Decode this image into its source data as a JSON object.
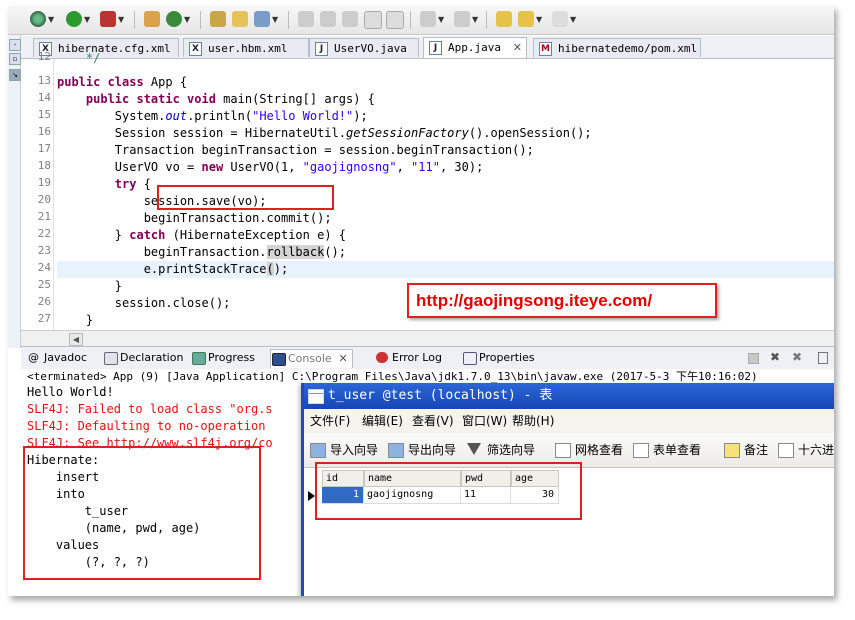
{
  "editor_tabs": [
    {
      "label": "hibernate.cfg.xml",
      "icon": "X"
    },
    {
      "label": "user.hbm.xml",
      "icon": "X"
    },
    {
      "label": "UserVO.java",
      "icon": "J"
    },
    {
      "label": "App.java",
      "icon": "J"
    },
    {
      "label": "hibernatedemo/pom.xml",
      "icon": "M"
    }
  ],
  "line_numbers": [
    "12",
    "13",
    "14",
    "15",
    "16",
    "17",
    "18",
    "19",
    "20",
    "21",
    "22",
    "23",
    "24",
    "25",
    "26",
    "27"
  ],
  "code": {
    "l13": {
      "kw": "public class",
      "rest": " App {"
    },
    "l14": {
      "kw": "public static void",
      "rest": " main(String[] args) {"
    },
    "l15": {
      "a": "System.",
      "fld": "out",
      "b": ".println(",
      "str": "\"Hello World!\"",
      "c": ");"
    },
    "l16": {
      "a": "Session session = HibernateUtil.",
      "ital": "getSessionFactory",
      "c": "().openSession();"
    },
    "l17": {
      "text": "Transaction beginTransaction = session.beginTransaction();"
    },
    "l18": {
      "a": "UserVO vo = ",
      "kw": "new",
      "b": " UserVO(1, ",
      "str1": "\"gaojignosng\"",
      "c": ", ",
      "str2": "\"11\"",
      "d": ", 30);"
    },
    "l19": {
      "kw": "try",
      "rest": " {"
    },
    "l20": {
      "text": "session.save(vo);"
    },
    "l21": {
      "text": "beginTransaction.commit();"
    },
    "l22": {
      "a": "} ",
      "kw": "catch",
      "b": " (HibernateException e) {"
    },
    "l23": {
      "a": "beginTransaction.",
      "occ": "rollback",
      "c": "();"
    },
    "l24": {
      "a": "e.printStackTrace",
      "occ": "(",
      "c": ");"
    },
    "l25": {
      "text": "}"
    },
    "l26": {
      "text": "session.close();"
    },
    "l27": {
      "text": "}"
    }
  },
  "watermark_url": "http://gaojingsong.iteye.com/",
  "view_tabs": [
    {
      "label": "Javadoc"
    },
    {
      "label": "Declaration"
    },
    {
      "label": "Progress"
    },
    {
      "label": "Console"
    },
    {
      "label": "Error Log"
    },
    {
      "label": "Properties"
    }
  ],
  "console": {
    "terminated": "<terminated> App (9) [Java Application] C:\\Program Files\\Java\\jdk1.7.0_13\\bin\\javaw.exe (2017-5-3 下午10:16:02)",
    "hello": "Hello World!",
    "slf1": "SLF4J: Failed to load class \"org.s",
    "slf2": "SLF4J: Defaulting to no-operation",
    "slf3": "SLF4J: See http://www.slf4j.org/co",
    "sql": [
      "Hibernate:",
      "    insert",
      "    into",
      "        t_user",
      "        (name, pwd, age)",
      "    values",
      "        (?, ?, ?)"
    ]
  },
  "db_window": {
    "title": "t_user @test (localhost) - 表",
    "menu": [
      "文件(F)",
      "编辑(E)",
      "查看(V)",
      "窗口(W)",
      "帮助(H)"
    ],
    "tools": [
      "导入向导",
      "导出向导",
      "筛选向导",
      "网格查看",
      "表单查看",
      "备注",
      "十六进"
    ],
    "columns": [
      "id",
      "name",
      "pwd",
      "age"
    ],
    "rows": [
      {
        "id": "1",
        "name": "gaojignosng",
        "pwd": "11",
        "age": "30"
      }
    ]
  },
  "colors": {
    "keyword": "#7f0055",
    "string": "#2a00ff",
    "field": "#0000c0",
    "annotation_red": "#e02020",
    "db_title": "#1546b8"
  }
}
